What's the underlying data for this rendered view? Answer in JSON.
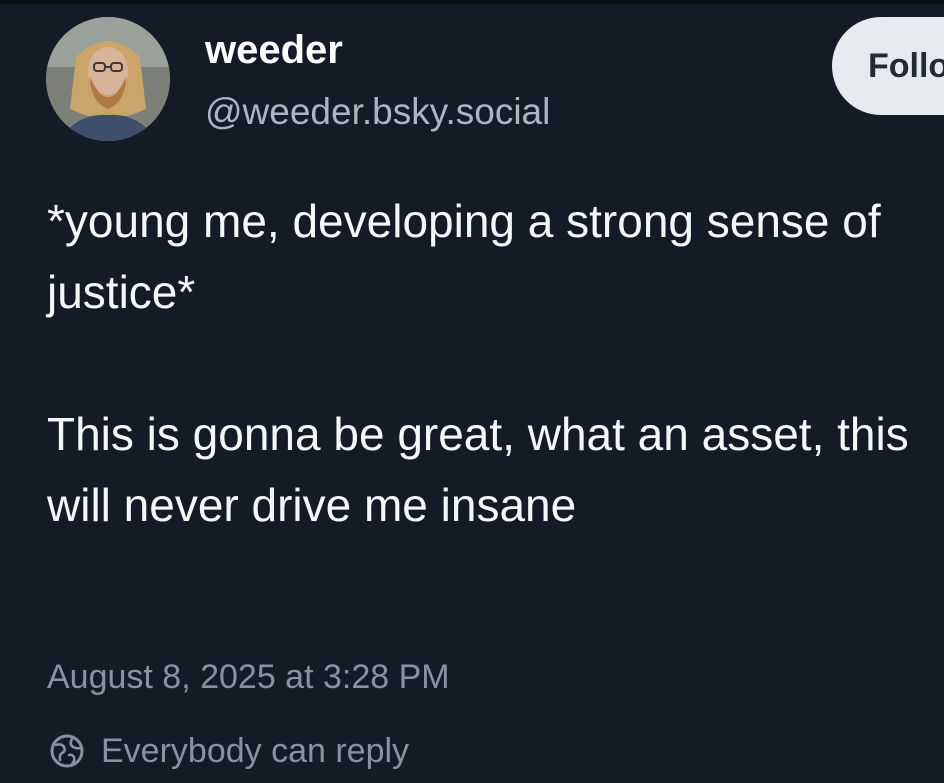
{
  "author": {
    "display_name": "weeder",
    "handle": "@weeder.bsky.social",
    "avatar_icon": "avatar-photo-icon"
  },
  "follow_button": {
    "label": "Follow"
  },
  "post": {
    "text": "*young me, developing a strong sense of justice*\n\nThis is gonna be great, what an asset, this will never drive me insane",
    "timestamp": "August 8, 2025 at 3:28 PM",
    "reply_setting": "Everybody can reply",
    "reply_icon": "globe-icon"
  },
  "colors": {
    "background": "#151b26",
    "text": "#f4f6f8",
    "secondary_text": "#8793a3",
    "handle_text": "#aab6c4",
    "button_bg": "#e6e9ee"
  }
}
